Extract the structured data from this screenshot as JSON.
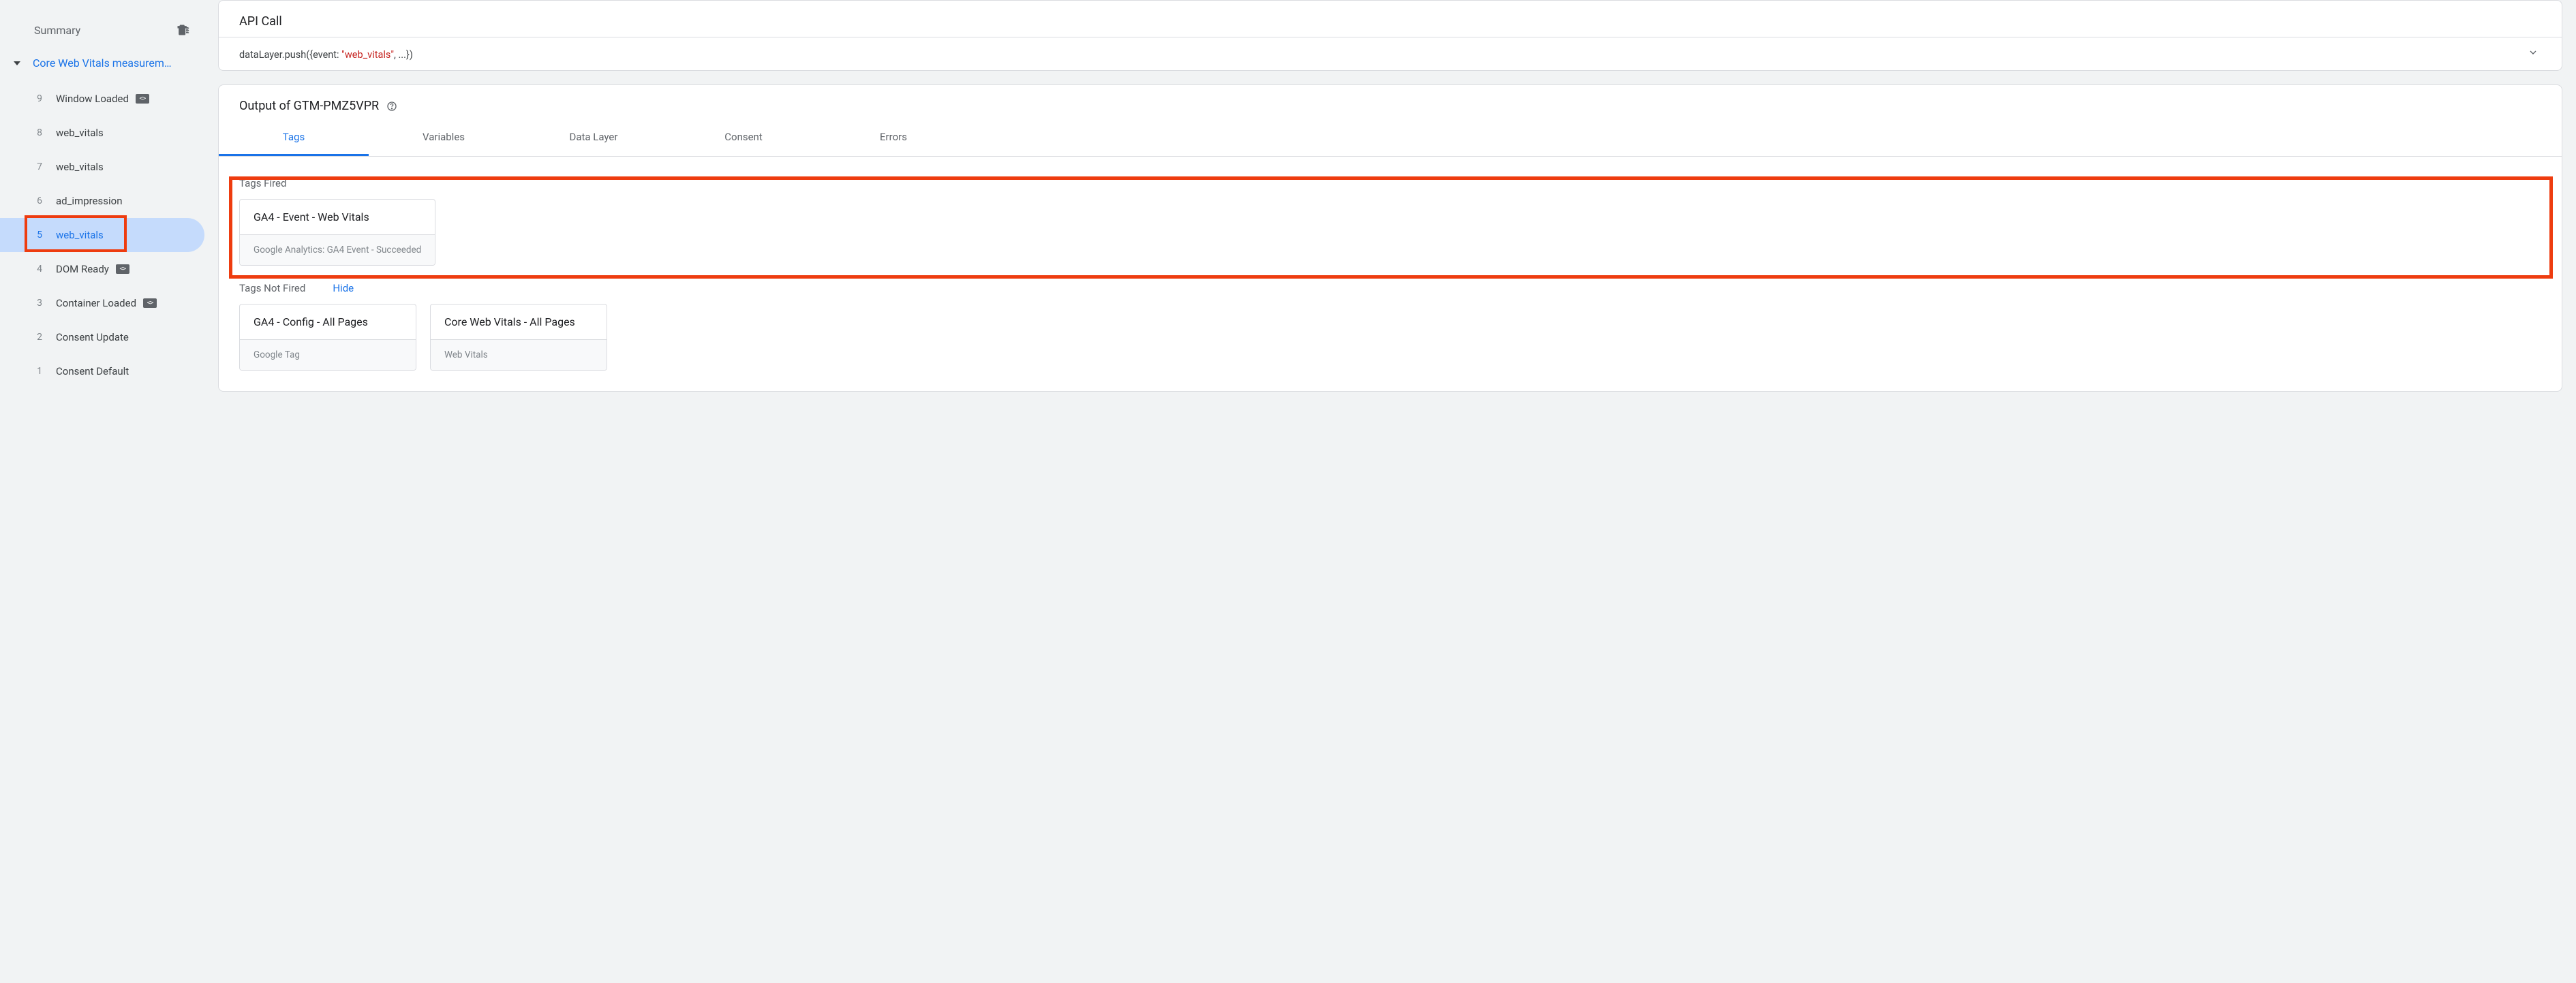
{
  "sidebar": {
    "summary_label": "Summary",
    "session_name": "Core Web Vitals measurem…",
    "events": [
      {
        "num": "9",
        "label": "Window Loaded",
        "code_icon": true,
        "active": false
      },
      {
        "num": "8",
        "label": "web_vitals",
        "code_icon": false,
        "active": false
      },
      {
        "num": "7",
        "label": "web_vitals",
        "code_icon": false,
        "active": false
      },
      {
        "num": "6",
        "label": "ad_impression",
        "code_icon": false,
        "active": false
      },
      {
        "num": "5",
        "label": "web_vitals",
        "code_icon": false,
        "active": true
      },
      {
        "num": "4",
        "label": "DOM Ready",
        "code_icon": true,
        "active": false
      },
      {
        "num": "3",
        "label": "Container Loaded",
        "code_icon": true,
        "active": false
      },
      {
        "num": "2",
        "label": "Consent Update",
        "code_icon": false,
        "active": false
      },
      {
        "num": "1",
        "label": "Consent Default",
        "code_icon": false,
        "active": false
      }
    ]
  },
  "api_card": {
    "title": "API Call",
    "code_prefix": "dataLayer.push({event: ",
    "code_str": "\"web_vitals\"",
    "code_suffix": ", ...})"
  },
  "output": {
    "heading": "Output of GTM-PMZ5VPR",
    "tabs": [
      {
        "label": "Tags",
        "active": true
      },
      {
        "label": "Variables",
        "active": false
      },
      {
        "label": "Data Layer",
        "active": false
      },
      {
        "label": "Consent",
        "active": false
      },
      {
        "label": "Errors",
        "active": false
      }
    ],
    "fired": {
      "title": "Tags Fired",
      "tags": [
        {
          "name": "GA4 - Event - Web Vitals",
          "status": "Google Analytics: GA4 Event - Succeeded"
        }
      ]
    },
    "not_fired": {
      "title": "Tags Not Fired",
      "hide": "Hide",
      "tags": [
        {
          "name": "GA4 - Config - All Pages",
          "status": "Google Tag"
        },
        {
          "name": "Core Web Vitals - All Pages",
          "status": "Web Vitals"
        }
      ]
    }
  }
}
